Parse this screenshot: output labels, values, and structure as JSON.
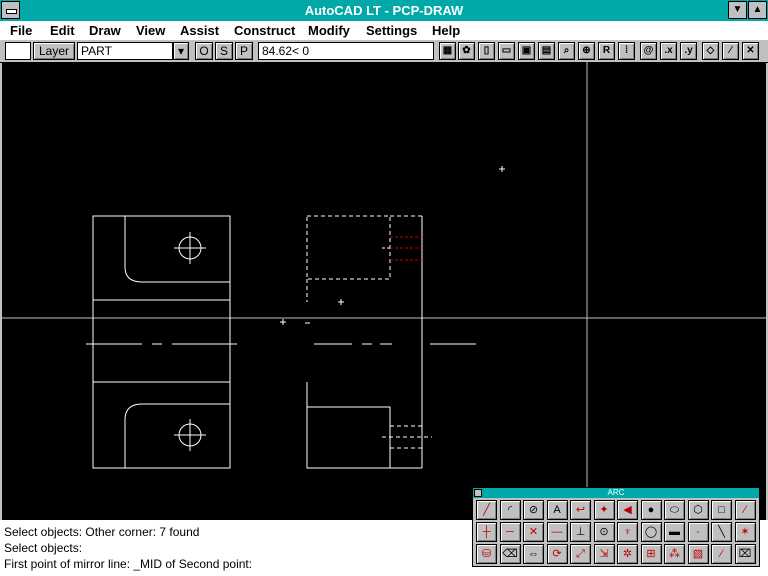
{
  "window": {
    "title": "AutoCAD LT - PCP-DRAW"
  },
  "menu": {
    "items": [
      "File",
      "Edit",
      "Draw",
      "View",
      "Assist",
      "Construct",
      "Modify",
      "Settings",
      "Help"
    ]
  },
  "toolbar": {
    "layer_button": "Layer",
    "layer_value": "PART",
    "dropdown_glyph": "▾",
    "ortho": "O",
    "snap": "S",
    "paper": "P",
    "coords": "84.62< 0",
    "icons": [
      "grid-icon",
      "regen-icon",
      "new-file-icon",
      "open-file-icon",
      "save-icon",
      "print-icon",
      "zoom-icon",
      "redraw-icon",
      "R",
      "dotted-grid-icon",
      "@",
      ".x",
      ".y",
      "erase-icon",
      "pen-icon",
      "cross-icon"
    ],
    "icon_glyphs": [
      "▦",
      "✿",
      "▯",
      "▭",
      "▣",
      "▤",
      "⌕",
      "⊕",
      "R",
      "⁞",
      "@",
      ".x",
      ".y",
      "◇",
      "∕",
      "✕"
    ]
  },
  "palette": {
    "title": "ARC",
    "icons": [
      [
        "line-icon",
        "arc-icon",
        "circle-icon",
        "text-icon",
        "polyline-icon",
        "point-icon",
        "solid-icon",
        "donut-icon",
        "ellipse-icon",
        "polygon-icon",
        "rectangle-icon",
        "pencil-icon"
      ],
      [
        "crosshair-icon",
        "hline-icon",
        "x-icon",
        "dash-icon",
        "dim-icon",
        "center-icon",
        "chain-icon",
        "circle2-icon",
        "table-icon",
        "dot-icon",
        "slash-icon",
        "snap-icon"
      ],
      [
        "block-icon",
        "eraser-icon",
        "move-icon",
        "rotate-icon",
        "scale-icon",
        "stretch-icon",
        "explode-icon",
        "trim-icon",
        "array-icon",
        "hatch-icon",
        "wand-icon",
        "edit-icon"
      ]
    ],
    "glyphs": [
      [
        "╱",
        "◜",
        "⊘",
        "A",
        "↩",
        "✦",
        "◀",
        "●",
        "⬭",
        "⬡",
        "□",
        "∕"
      ],
      [
        "┼",
        "─",
        "✕",
        "—",
        "⊥",
        "⊙",
        "♆",
        "◯",
        "▬",
        "·",
        "╲",
        "✶"
      ],
      [
        "⛁",
        "⌫",
        "⇔",
        "⟳",
        "⤢",
        "⇲",
        "✲",
        "⊞",
        "⁂",
        "▧",
        "⁄",
        "⌧"
      ]
    ],
    "red_cells": [
      "0-0",
      "0-4",
      "0-5",
      "0-6",
      "0-11",
      "1-0",
      "1-1",
      "1-2",
      "1-3",
      "1-6",
      "1-11",
      "2-0",
      "2-3",
      "2-4",
      "2-5",
      "2-6",
      "2-7",
      "2-8",
      "2-9",
      "2-10"
    ]
  },
  "command": {
    "lines": [
      "Select objects: Other corner: 7 found",
      "Select objects:",
      "First point of mirror line: _MID of Second point:"
    ]
  },
  "colors": {
    "titlebar": "#00a8a8",
    "drawing_bg": "#000000",
    "red": "#c00000"
  }
}
